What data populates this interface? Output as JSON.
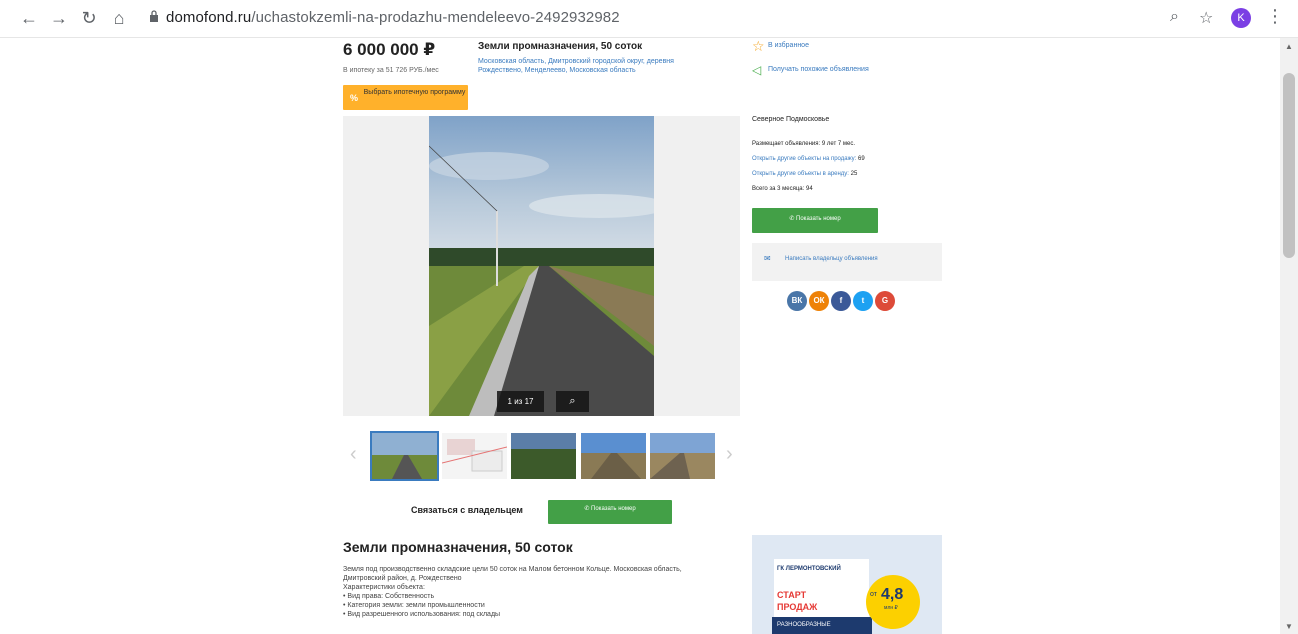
{
  "browser": {
    "url_host": "domofond.ru",
    "url_path": "/uchastokzemli-na-prodazhu-mendeleevo-2492932982",
    "profile_initial": "K"
  },
  "listing": {
    "price": "6 000 000 ₽",
    "mortgage_text": "В ипотеку за 51 726 РУБ./мес",
    "mortgage_button": "Выбрать ипотечную программу",
    "mortgage_icon_text": "%",
    "title": "Земли промназначения, 50 соток",
    "address": "Московская область, Дмитровский городской округ, деревня Рождествено, Менделеево, Московская область",
    "favorite": "В избранное",
    "similar": "Получать похожие объявления"
  },
  "gallery": {
    "counter": "1 из 17",
    "zoom_icon": "search-icon",
    "prev_arrow": "‹",
    "next_arrow": "›"
  },
  "seller": {
    "name": "Северное Подмосковье",
    "posting_since": "Размещает объявления: 9 лет 7 мес.",
    "other_sale_label": "Открыть другие объекты на продажу:",
    "other_sale_count": "69",
    "other_rent_label": "Открыть другие объекты в аренду:",
    "other_rent_count": "25",
    "total_label": "Всего за 3 месяца:",
    "total_count": "94",
    "show_phone": "Показать номер",
    "write_owner": "Написать владельцу объявления",
    "social": [
      "ВК",
      "ОК",
      "f",
      "t",
      "G"
    ]
  },
  "contact": {
    "label": "Связаться с владельцем",
    "button": "Показать номер"
  },
  "description": {
    "title": "Земли промназначения, 50 соток",
    "lines": [
      "Земля под производственно складские цели 50 соток на Малом бетонном Кольце. Московская область,",
      "Дмитровский район, д. Рождествено",
      "Характеристики объекта:",
      "• Вид права: Собственность",
      "• Категория земли: земли промышленности",
      "• Вид разрешенного использования: под склады"
    ]
  },
  "ad": {
    "brand": "ГК ЛЕРМОНТОВСКИЙ",
    "line1": "СТАРТ",
    "line2": "ПРОДАЖ",
    "line3": "РАЗНООБРАЗНЫЕ",
    "badge_prefix": "от",
    "badge_value": "4,8",
    "badge_unit": "млн ₽"
  },
  "colors": {
    "accent_green": "#43a047",
    "mortgage_orange": "#ffb12b",
    "link_blue": "#3a7bbf"
  }
}
